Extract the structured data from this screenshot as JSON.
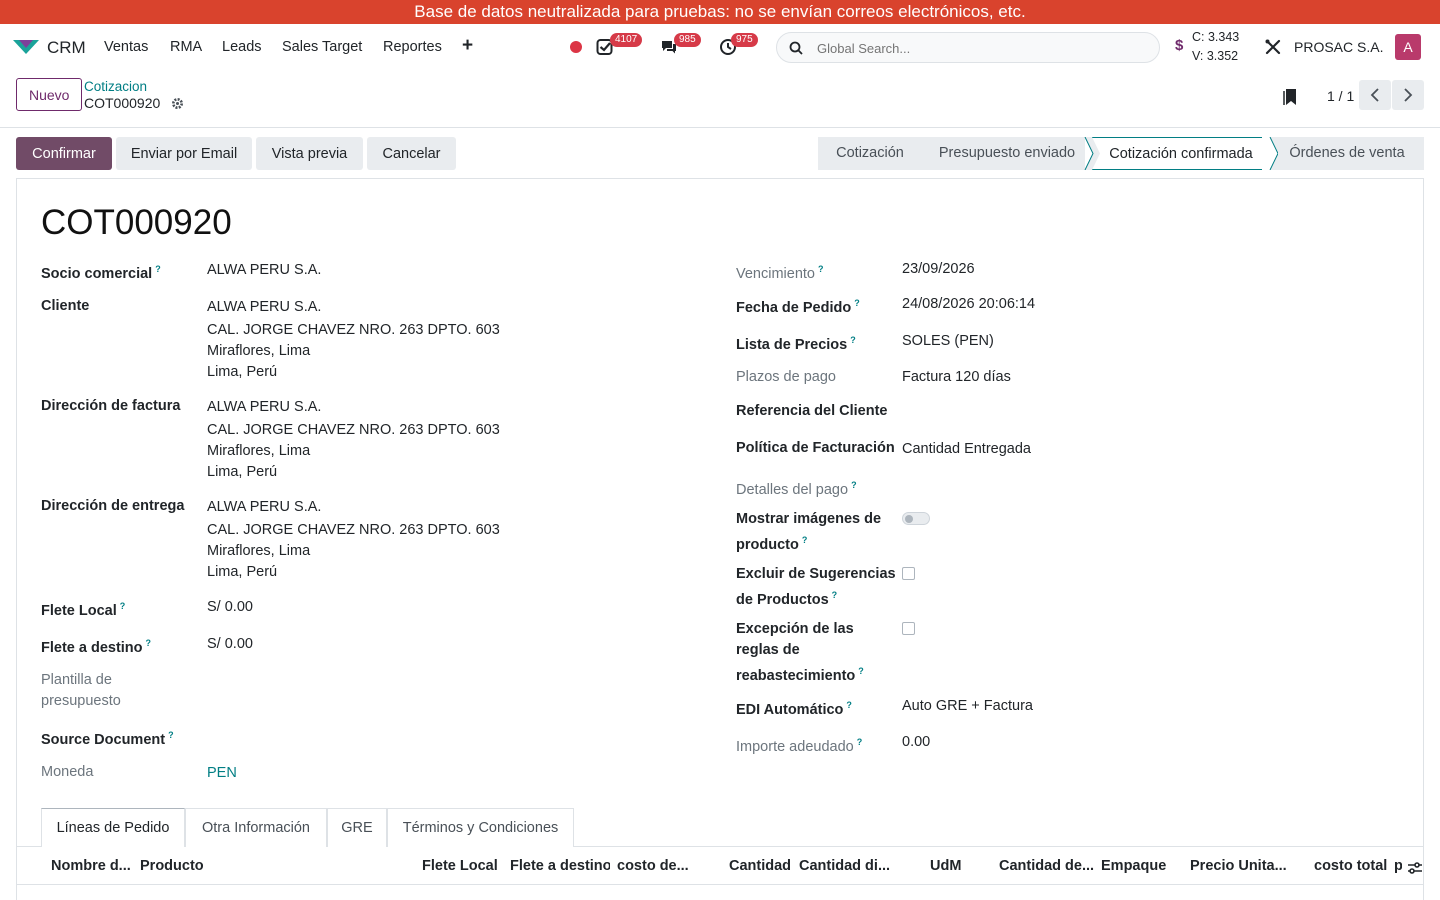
{
  "banner": "Base de datos neutralizada para pruebas: no se envían correos electrónicos, etc.",
  "nav": {
    "app": "CRM",
    "menu": [
      "Ventas",
      "RMA",
      "Leads",
      "Sales Target",
      "Reportes"
    ],
    "badges": {
      "activities": "4107",
      "messages": "985",
      "timers": "975"
    },
    "search_placeholder": "Global Search...",
    "rates": {
      "c": "C: 3.343",
      "v": "V: 3.352"
    },
    "company": "PROSAC S.A.",
    "avatar": "A"
  },
  "control": {
    "new_label": "Nuevo",
    "breadcrumb_parent": "Cotizacion",
    "breadcrumb_current": "COT000920",
    "pager": "1 / 1"
  },
  "actions": {
    "confirm": "Confirmar",
    "email": "Enviar por Email",
    "preview": "Vista previa",
    "cancel": "Cancelar"
  },
  "stages": [
    "Cotización",
    "Presupuesto enviado",
    "Cotización confirmada",
    "Órdenes de venta"
  ],
  "active_stage": "Cotización confirmada",
  "record": {
    "title": "COT000920",
    "left": {
      "socio_label": "Socio comercial",
      "socio_value": "ALWA PERU S.A.",
      "cliente_label": "Cliente",
      "cliente_lines": [
        "ALWA PERU S.A.",
        "CAL. JORGE CHAVEZ NRO. 263 DPTO. 603",
        "Miraflores, Lima",
        "Lima, Perú"
      ],
      "factura_label": "Dirección de factura",
      "factura_lines": [
        "ALWA PERU S.A.",
        "CAL. JORGE CHAVEZ NRO. 263 DPTO. 603",
        "Miraflores, Lima",
        "Lima, Perú"
      ],
      "entrega_label": "Dirección de entrega",
      "entrega_lines": [
        "ALWA PERU S.A.",
        "CAL. JORGE CHAVEZ NRO. 263 DPTO. 603",
        "Miraflores, Lima",
        "Lima, Perú"
      ],
      "flete_local_label": "Flete Local",
      "flete_local_value": "S/ 0.00",
      "flete_destino_label": "Flete a destino",
      "flete_destino_value": "S/ 0.00",
      "plantilla_label_1": "Plantilla de",
      "plantilla_label_2": "presupuesto",
      "source_label": "Source Document",
      "moneda_label": "Moneda",
      "moneda_value": "PEN"
    },
    "right": {
      "vencimiento_label": "Vencimiento",
      "vencimiento_value": "23/09/2026",
      "fecha_label": "Fecha de Pedido",
      "fecha_value": "24/08/2026 20:06:14",
      "lista_label": "Lista de Precios",
      "lista_value": "SOLES (PEN)",
      "plazos_label": "Plazos de pago",
      "plazos_value": "Factura 120 días",
      "referencia_label": "Referencia del Cliente",
      "politica_label": "Política de Facturación",
      "politica_value": "Cantidad Entregada",
      "detalles_label": "Detalles del pago",
      "mostrar_label_1": "Mostrar imágenes de",
      "mostrar_label_2": "producto",
      "excluir_label_1": "Excluir de Sugerencias",
      "excluir_label_2": "de Productos",
      "excepcion_label_1": "Excepción de las",
      "excepcion_label_2": "reglas de",
      "excepcion_label_3": "reabastecimiento",
      "edi_label": "EDI Automático",
      "edi_value": "Auto GRE + Factura",
      "importe_label": "Importe adeudado",
      "importe_value": "0.00"
    }
  },
  "tabs": [
    "Líneas de Pedido",
    "Otra Información",
    "GRE",
    "Términos y Condiciones"
  ],
  "columns": [
    "Nombre d...",
    "Producto",
    "Flete Local",
    "Flete a destino",
    "costo de...",
    "Cantidad",
    "Cantidad di...",
    "UdM",
    "Cantidad de...",
    "Empaque",
    "Precio Unita...",
    "costo total",
    "p"
  ]
}
